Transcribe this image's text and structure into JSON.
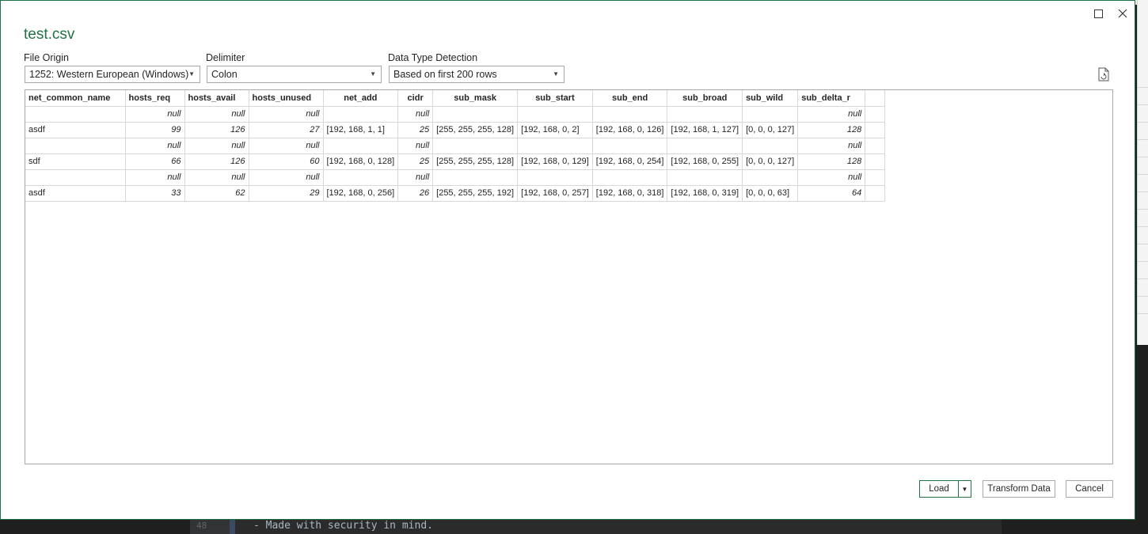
{
  "background": {
    "editor_line_number": "48",
    "editor_code": "- Made with security in mind."
  },
  "dialog": {
    "title": "test.csv",
    "file_origin": {
      "label": "File Origin",
      "value": "1252: Western European (Windows)"
    },
    "delimiter": {
      "label": "Delimiter",
      "value": "Colon"
    },
    "data_type_detection": {
      "label": "Data Type Detection",
      "value": "Based on first 200 rows"
    },
    "icons": {
      "maximize": "maximize-icon",
      "close": "close-icon",
      "refresh_doc": "document-refresh-icon"
    }
  },
  "table": {
    "columns": [
      "net_common_name",
      "hosts_req",
      "hosts_avail",
      "hosts_unused",
      "net_add",
      "cidr",
      "sub_mask",
      "sub_start",
      "sub_end",
      "sub_broad",
      "sub_wild",
      "sub_delta_r",
      ""
    ],
    "rows": [
      [
        "",
        "null",
        "null",
        "null",
        "",
        "null",
        "",
        "",
        "",
        "",
        "",
        "null",
        ""
      ],
      [
        "asdf",
        "99",
        "126",
        "27",
        "[192, 168, 1, 1]",
        "25",
        "[255, 255, 255, 128]",
        "[192, 168, 0, 2]",
        "[192, 168, 0, 126]",
        "[192, 168, 1, 127]",
        "[0, 0, 0, 127]",
        "128",
        ""
      ],
      [
        "",
        "null",
        "null",
        "null",
        "",
        "null",
        "",
        "",
        "",
        "",
        "",
        "null",
        ""
      ],
      [
        "sdf",
        "66",
        "126",
        "60",
        "[192, 168, 0, 128]",
        "25",
        "[255, 255, 255, 128]",
        "[192, 168, 0, 129]",
        "[192, 168, 0, 254]",
        "[192, 168, 0, 255]",
        "[0, 0, 0, 127]",
        "128",
        ""
      ],
      [
        "",
        "null",
        "null",
        "null",
        "",
        "null",
        "",
        "",
        "",
        "",
        "",
        "null",
        ""
      ],
      [
        "asdf",
        "33",
        "62",
        "29",
        "[192, 168, 0, 256]",
        "26",
        "[255, 255, 255, 192]",
        "[192, 168, 0, 257]",
        "[192, 168, 0, 318]",
        "[192, 168, 0, 319]",
        "[0, 0, 0, 63]",
        "64",
        ""
      ]
    ]
  },
  "buttons": {
    "load": "Load",
    "transform": "Transform Data",
    "cancel": "Cancel"
  },
  "colors": {
    "accent": "#217346",
    "border": "#a9a9a9"
  }
}
